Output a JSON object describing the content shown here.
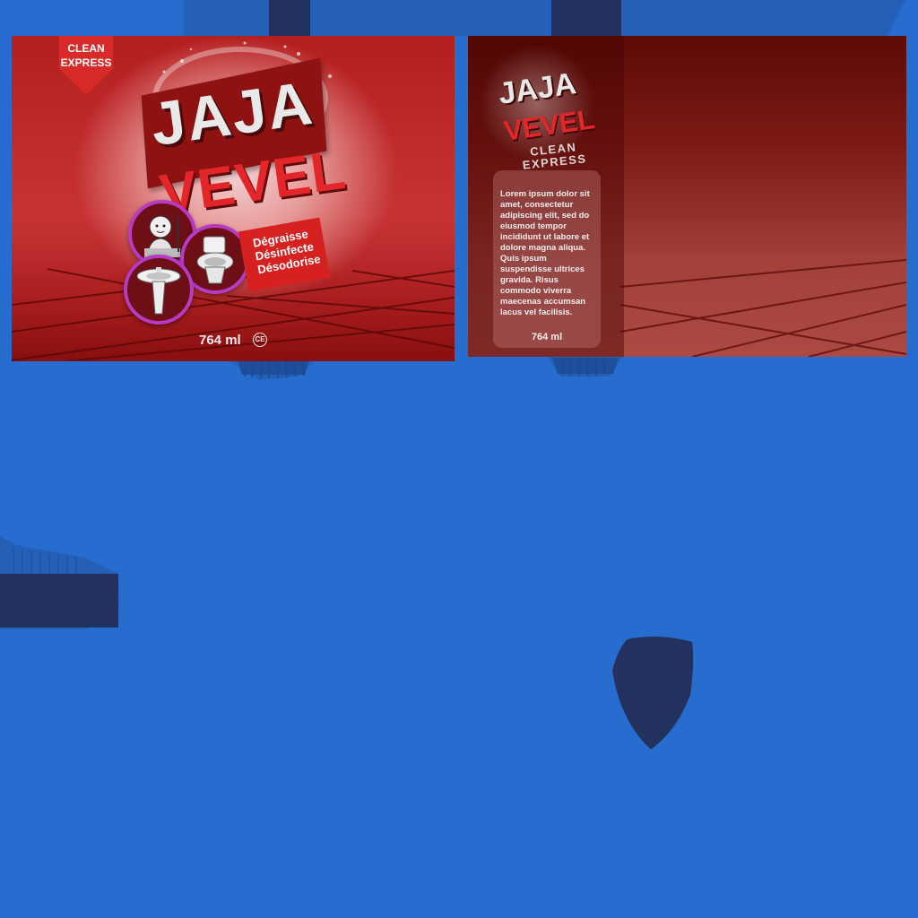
{
  "colors": {
    "background": "#276ccf",
    "dark_navy": "#22315e",
    "label_red": "#c02525",
    "accent_purple": "#b63ac3"
  },
  "front_label": {
    "badge": {
      "line1": "CLEAN",
      "line2": "EXPRESS"
    },
    "brand": {
      "line1": "JAJA",
      "line2": "VEVEL"
    },
    "benefits": [
      "Dégraisse",
      "Désinfecte",
      "Désodorise"
    ],
    "icons": [
      "child-icon",
      "toilet-icon",
      "sink-icon"
    ],
    "volume": "764 ml",
    "certification": "CE"
  },
  "back_label": {
    "brand": {
      "line1": "JAJA",
      "line2": "VEVEL",
      "tagline_1": "CLEAN",
      "tagline_2": "EXPRESS"
    },
    "description": "Lorem ipsum dolor sit amet, consectetur adipiscing elit, sed do eiusmod tempor incididunt ut labore et dolore magna aliqua. Quis ipsum suspendisse ultrices gravida. Risus commodo viverra maecenas accumsan lacus vel facilisis.",
    "volume": "764 ml"
  }
}
